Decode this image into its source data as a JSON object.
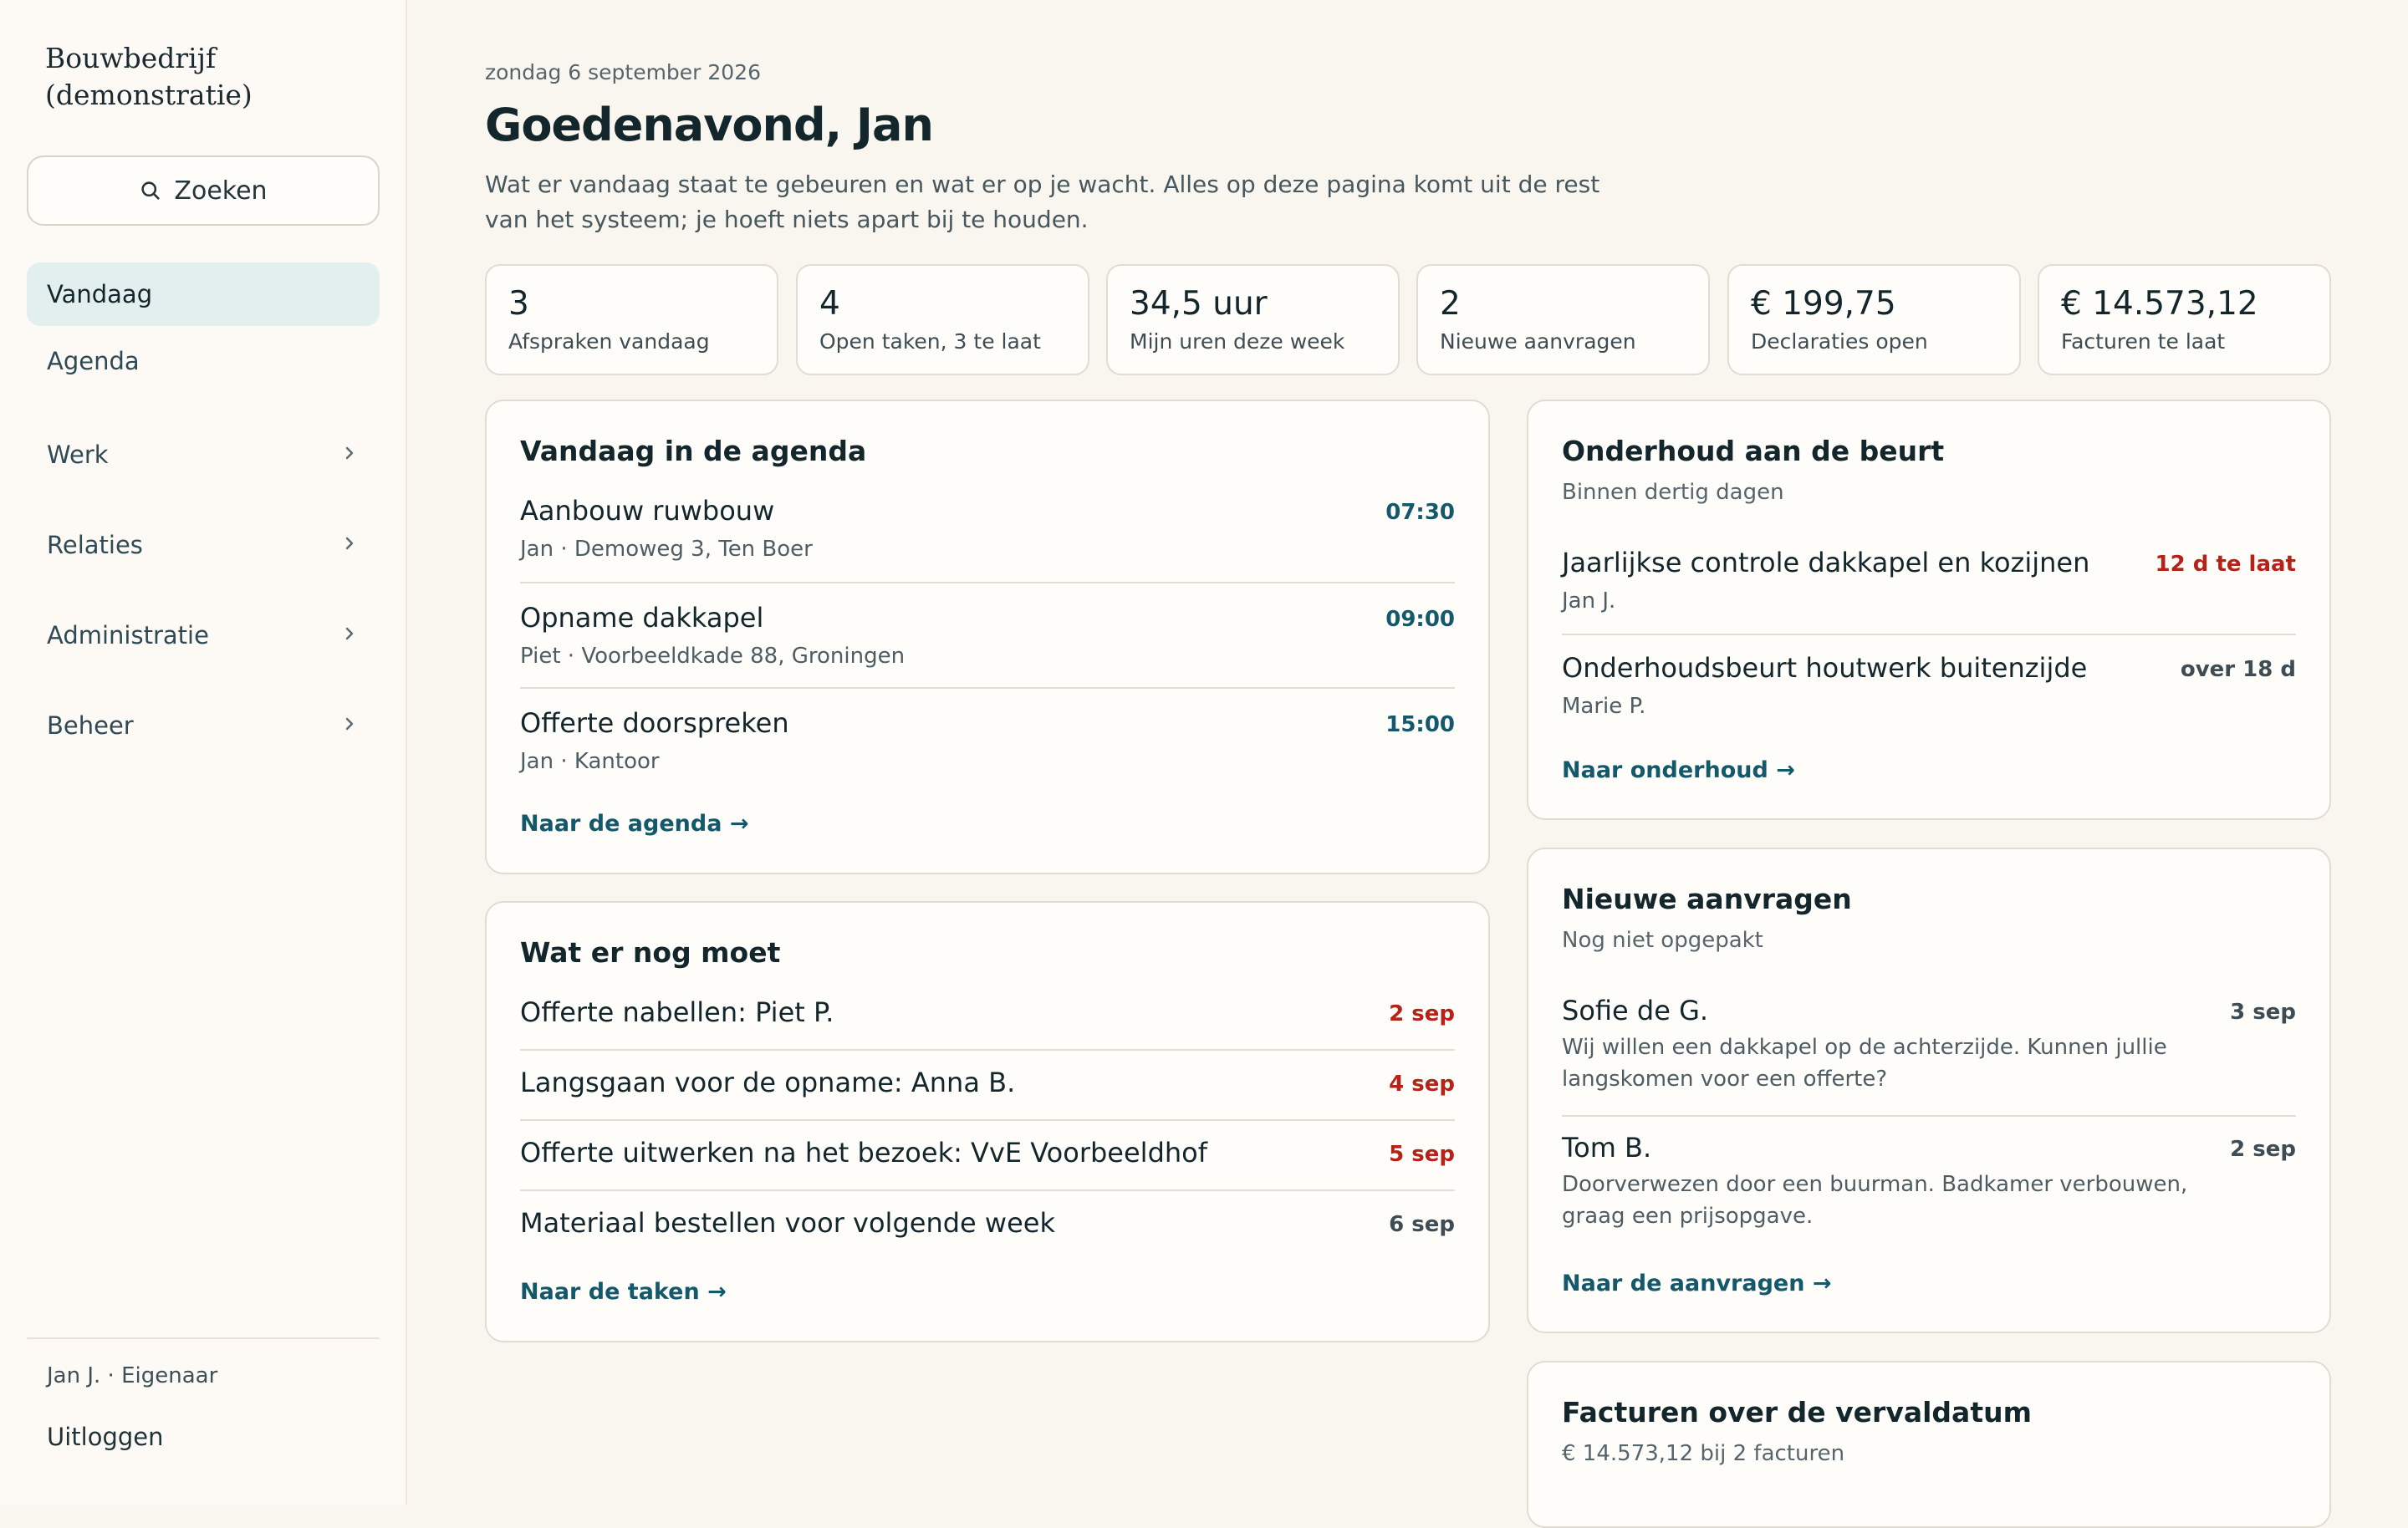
{
  "sidebar": {
    "brand": "Bouwbedrijf (demonstratie)",
    "search_label": "Zoeken",
    "nav": [
      {
        "label": "Vandaag"
      },
      {
        "label": "Agenda"
      },
      {
        "label": "Werk"
      },
      {
        "label": "Relaties"
      },
      {
        "label": "Administratie"
      },
      {
        "label": "Beheer"
      }
    ],
    "user": "Jan J. · Eigenaar",
    "logout": "Uitloggen"
  },
  "header": {
    "date": "zondag 6 september 2026",
    "greeting": "Goedenavond, Jan",
    "intro": "Wat er vandaag staat te gebeuren en wat er op je wacht. Alles op deze pagina komt uit de rest van het systeem; je hoeft niets apart bij te houden."
  },
  "stats": [
    {
      "value": "3",
      "label": "Afspraken vandaag"
    },
    {
      "value": "4",
      "label": "Open taken, 3 te laat"
    },
    {
      "value": "34,5 uur",
      "label": "Mijn uren deze week"
    },
    {
      "value": "2",
      "label": "Nieuwe aanvragen"
    },
    {
      "value": "€ 199,75",
      "label": "Declaraties open"
    },
    {
      "value": "€ 14.573,12",
      "label": "Facturen te laat"
    }
  ],
  "agenda": {
    "title": "Vandaag in de agenda",
    "items": [
      {
        "title": "Aanbouw ruwbouw",
        "meta": "Jan · Demoweg 3, Ten Boer",
        "time": "07:30"
      },
      {
        "title": "Opname dakkapel",
        "meta": "Piet · Voorbeeldkade 88, Groningen",
        "time": "09:00"
      },
      {
        "title": "Offerte doorspreken",
        "meta": "Jan · Kantoor",
        "time": "15:00"
      }
    ],
    "link": "Naar de agenda →"
  },
  "tasks": {
    "title": "Wat er nog moet",
    "items": [
      {
        "title": "Offerte nabellen: Piet P.",
        "date": "2 sep"
      },
      {
        "title": "Langsgaan voor de opname: Anna B.",
        "date": "4 sep"
      },
      {
        "title": "Offerte uitwerken na het bezoek: VvE Voorbeeldhof",
        "date": "5 sep"
      },
      {
        "title": "Materiaal bestellen voor volgende week",
        "date": "6 sep"
      }
    ],
    "link": "Naar de taken →"
  },
  "maintenance": {
    "title": "Onderhoud aan de beurt",
    "subtitle": "Binnen dertig dagen",
    "items": [
      {
        "title": "Jaarlijkse controle dakkapel en kozijnen",
        "meta": "Jan J.",
        "status": "12 d te laat"
      },
      {
        "title": "Onderhoudsbeurt houtwerk buitenzijde",
        "meta": "Marie P.",
        "status": "over 18 d"
      }
    ],
    "link": "Naar onderhoud →"
  },
  "requests": {
    "title": "Nieuwe aanvragen",
    "subtitle": "Nog niet opgepakt",
    "items": [
      {
        "name": "Sofie de G.",
        "text": "Wij willen een dakkapel op de achterzijde. Kunnen jullie langskomen voor een offerte?",
        "date": "3 sep"
      },
      {
        "name": "Tom B.",
        "text": "Doorverwezen door een buurman. Badkamer verbouwen, graag een prijsopgave.",
        "date": "2 sep"
      }
    ],
    "link": "Naar de aanvragen →"
  },
  "invoices": {
    "title": "Facturen over de vervaldatum",
    "subtitle": "€ 14.573,12 bij 2 facturen"
  },
  "colors": {
    "accent": "#14596b",
    "overdue": "#b42318",
    "background": "#f9f5ef",
    "active_nav": "#e2efee"
  }
}
